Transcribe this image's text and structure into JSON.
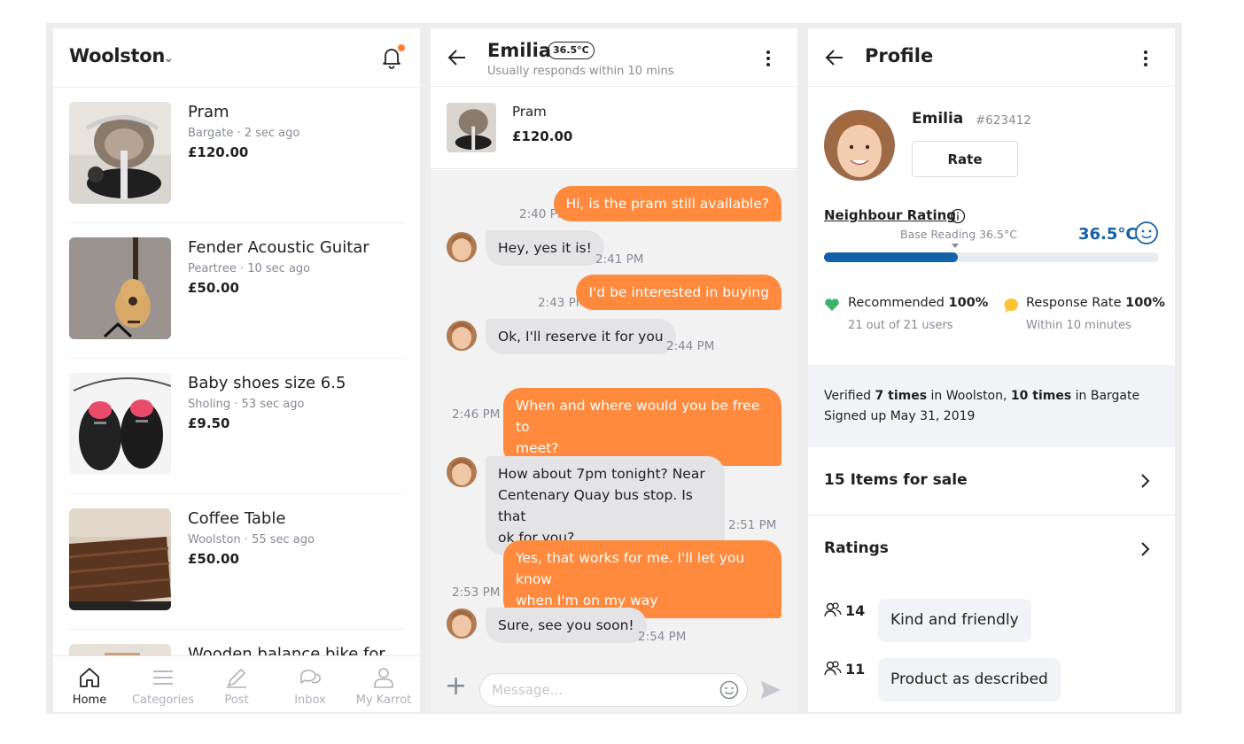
{
  "listings_screen": {
    "location": "Woolston",
    "items": [
      {
        "title": "Pram",
        "meta": "Bargate · 2 sec ago",
        "price": "£120.00"
      },
      {
        "title": "Fender Acoustic Guitar",
        "meta": "Peartree · 10 sec ago",
        "price": "£50.00"
      },
      {
        "title": "Baby shoes size 6.5",
        "meta": "Sholing · 53 sec ago",
        "price": "£9.50"
      },
      {
        "title": "Coffee Table",
        "meta": "Woolston · 55 sec ago",
        "price": "£50.00"
      },
      {
        "title": "Wooden balance bike for",
        "meta": "",
        "price": ""
      }
    ],
    "tabs": [
      "Home",
      "Categories",
      "Post",
      "Inbox",
      "My Karrot"
    ],
    "active_tab": "Home"
  },
  "chat_screen": {
    "name": "Emilia",
    "temp_badge": "36.5°C",
    "subtitle": "Usually responds within 10 mins",
    "product": {
      "title": "Pram",
      "price": "£120.00"
    },
    "messages": [
      {
        "from": "me",
        "text": "Hi, is the pram still available?",
        "time": "2:40 PM"
      },
      {
        "from": "them",
        "text": "Hey, yes it is!",
        "time": "2:41 PM"
      },
      {
        "from": "me",
        "text": "I'd be interested in buying",
        "time": "2:43 PM"
      },
      {
        "from": "them",
        "text": "Ok, I'll reserve it for you",
        "time": "2:44 PM"
      },
      {
        "from": "me",
        "lines": [
          "When and where would you be free to",
          "meet?"
        ],
        "time": "2:46 PM"
      },
      {
        "from": "them",
        "lines": [
          "How about 7pm tonight? Near",
          "Centenary Quay bus stop. Is that",
          "ok for you?"
        ],
        "time": "2:51 PM"
      },
      {
        "from": "me",
        "lines": [
          "Yes, that works for me. I'll let you know",
          "when I'm on my way"
        ],
        "time": "2:53 PM"
      },
      {
        "from": "them",
        "text": "Sure, see you soon!",
        "time": "2:54 PM"
      }
    ],
    "composer_placeholder": "Message..."
  },
  "profile_screen": {
    "title": "Profile",
    "name": "Emilia",
    "user_id": "#623412",
    "rate_label": "Rate",
    "neighbour_rating_label": "Neighbour Rating",
    "base_reading": "Base Reading 36.5°C",
    "temperature": "36.5°C",
    "temperature_fill_fraction": 0.4,
    "recommended": {
      "label": "Recommended",
      "value": "100%",
      "sub": "21 out of 21 users"
    },
    "response_rate": {
      "label": "Response Rate",
      "value": "100%",
      "sub": "Within 10 minutes"
    },
    "verified": {
      "prefix": "Verified",
      "count1": "7 times",
      "mid": "in Woolston,",
      "count2": "10 times",
      "suffix": "in Bargate"
    },
    "signed_up": "Signed up May 31, 2019",
    "items_for_sale": "15 Items for sale",
    "ratings_label": "Ratings",
    "rating_tags": [
      {
        "count": "14",
        "label": "Kind and friendly"
      },
      {
        "count": "11",
        "label": "Product as described"
      }
    ]
  },
  "colors": {
    "accent": "#ff8a3d",
    "temperature_blue": "#1561a9",
    "heart_green": "#3bb36b",
    "response_yellow": "#ffc233"
  }
}
